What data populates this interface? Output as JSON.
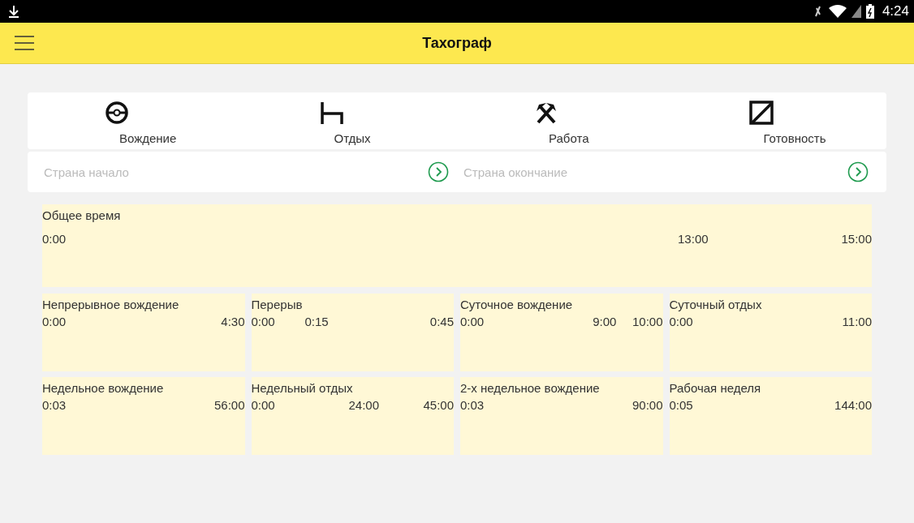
{
  "status_bar": {
    "time": "4:24"
  },
  "app_bar": {
    "title": "Тахограф"
  },
  "modes": [
    {
      "kind": "driving",
      "label": "Вождение"
    },
    {
      "kind": "rest",
      "label": "Отдых"
    },
    {
      "kind": "work",
      "label": "Работа"
    },
    {
      "kind": "availability",
      "label": "Готовность"
    }
  ],
  "country_fields": [
    {
      "placeholder": "Страна начало"
    },
    {
      "placeholder": "Страна окончание"
    }
  ],
  "total": {
    "title": "Общее время",
    "ticks": [
      "0:00",
      "13:00",
      "15:00"
    ]
  },
  "panels": [
    {
      "title": "Непрерывное вождение",
      "ticks": [
        "0:00",
        "4:30"
      ]
    },
    {
      "title": "Перерыв",
      "ticks": [
        "0:00",
        "0:15",
        "0:45"
      ]
    },
    {
      "title": "Суточное вождение",
      "ticks": [
        "0:00",
        "9:00",
        "10:00"
      ]
    },
    {
      "title": "Суточный отдых",
      "ticks": [
        "0:00",
        "11:00"
      ]
    },
    {
      "title": "Недельное вождение",
      "ticks": [
        "0:03",
        "56:00"
      ]
    },
    {
      "title": "Недельный отдых",
      "ticks": [
        "0:00",
        "24:00",
        "45:00"
      ]
    },
    {
      "title": "2-х недельное вождение",
      "ticks": [
        "0:03",
        "90:00"
      ]
    },
    {
      "title": "Рабочая неделя",
      "ticks": [
        "0:05",
        "144:00"
      ]
    }
  ]
}
